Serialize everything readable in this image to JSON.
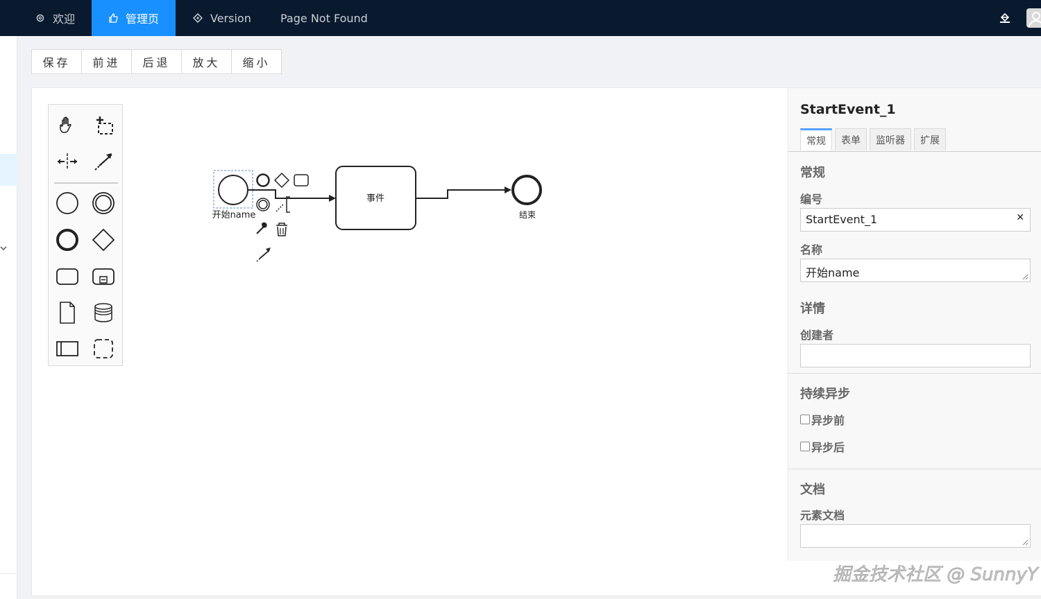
{
  "nav": {
    "items": [
      {
        "label": "欢迎",
        "icon": "gear-icon"
      },
      {
        "label": "管理页",
        "icon": "thumbs-up-icon",
        "active": true
      },
      {
        "label": "Version",
        "icon": "diamond-target-icon"
      },
      {
        "label": "Page Not Found"
      }
    ],
    "right_icons": [
      "paint-bucket-icon",
      "user-avatar-icon"
    ]
  },
  "toolbar": {
    "save": "保存",
    "forward": "前进",
    "back": "后退",
    "zoom_in": "放大",
    "zoom_out": "缩小"
  },
  "palette": {
    "tools": [
      "hand-tool-icon",
      "lasso-tool-icon",
      "space-tool-icon",
      "global-connect-tool-icon"
    ],
    "shapes": [
      "start-event-icon",
      "intermediate-event-icon",
      "end-event-icon",
      "gateway-icon",
      "task-icon",
      "subprocess-icon",
      "data-object-icon",
      "data-store-icon",
      "pool-icon",
      "group-icon"
    ]
  },
  "diagram": {
    "start_event_label": "开始name",
    "task_label": "事件",
    "end_event_label": "结束"
  },
  "properties": {
    "title": "StartEvent_1",
    "tabs": [
      {
        "label": "常规",
        "active": true
      },
      {
        "label": "表单"
      },
      {
        "label": "监听器"
      },
      {
        "label": "扩展"
      }
    ],
    "general_heading": "常规",
    "id_label": "编号",
    "id_value": "StartEvent_1",
    "name_label": "名称",
    "name_value": "开始name",
    "details_heading": "详情",
    "initiator_label": "创建者",
    "initiator_value": "",
    "async_heading": "持续异步",
    "async_before": "异步前",
    "async_after": "异步后",
    "doc_heading": "文档",
    "doc_label": "元素文档",
    "doc_value": ""
  },
  "watermark": "掘金技术社区 @ SunnyY",
  "colors": {
    "nav_bg": "#0a1a2e",
    "nav_active": "#1890ff",
    "tab_accent": "#52a1ff"
  }
}
